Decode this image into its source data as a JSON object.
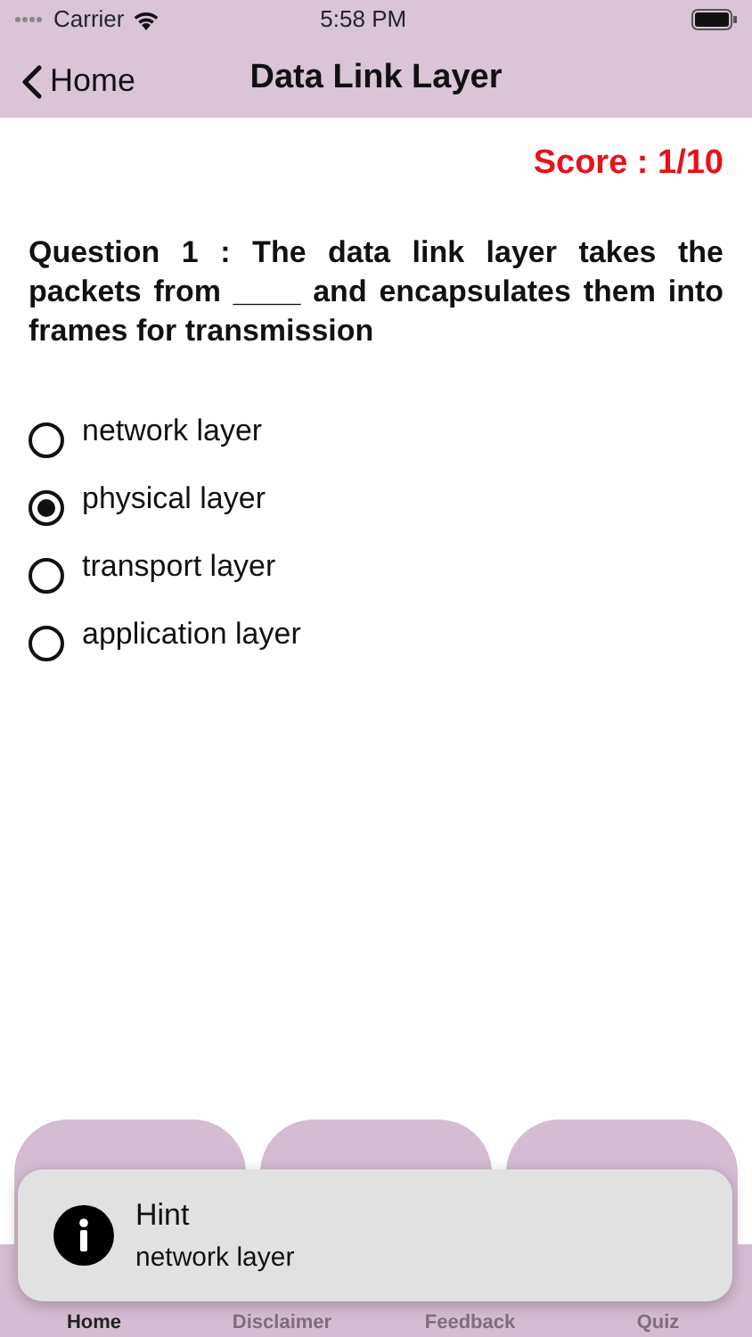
{
  "status_bar": {
    "carrier": "Carrier",
    "time": "5:58 PM"
  },
  "nav": {
    "back": "Home",
    "title": "Data Link Layer"
  },
  "score": "Score : 1/10",
  "question": "Question 1 : The data link layer takes the packets from ____ and encapsulates them into frames for transmission",
  "options": [
    {
      "label": "network layer",
      "selected": false
    },
    {
      "label": "physical layer",
      "selected": true
    },
    {
      "label": "transport layer",
      "selected": false
    },
    {
      "label": "application layer",
      "selected": false
    }
  ],
  "toast": {
    "title": "Hint",
    "message": "network layer"
  },
  "tabs": [
    {
      "label": "Home",
      "selected": true
    },
    {
      "label": "Disclaimer",
      "selected": false
    },
    {
      "label": "Feedback",
      "selected": false
    },
    {
      "label": "Quiz",
      "selected": false
    }
  ]
}
